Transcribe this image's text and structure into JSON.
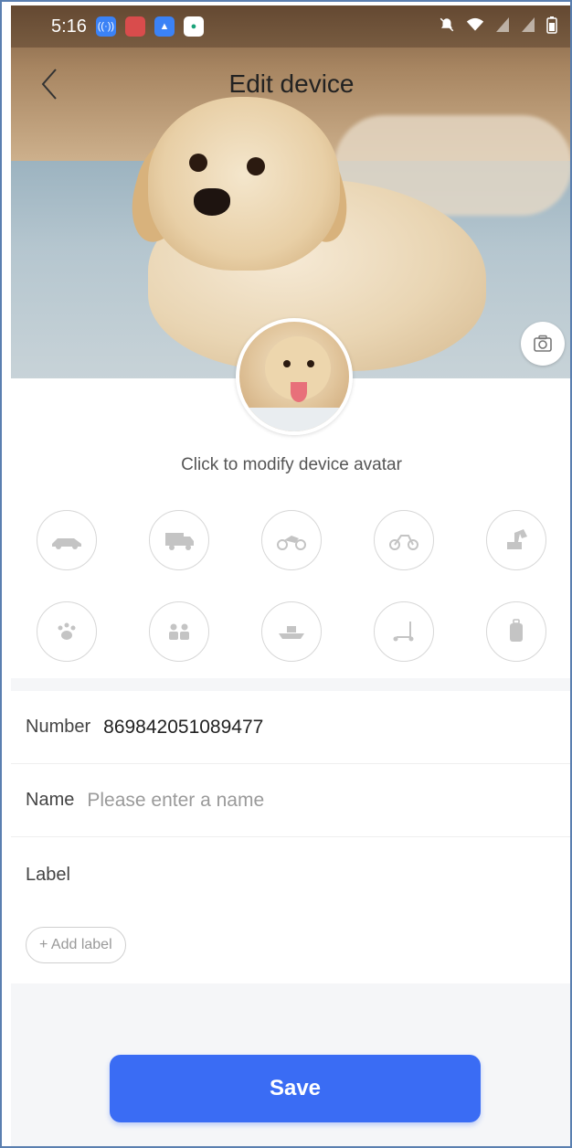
{
  "status_bar": {
    "time": "5:16",
    "app_icons": [
      "signal-app-icon",
      "red-app-icon",
      "mountain-app-icon",
      "location-app-icon"
    ],
    "right_icons": [
      "mute-icon",
      "wifi-icon",
      "signal-icon",
      "signal-icon",
      "battery-icon"
    ]
  },
  "header": {
    "title": "Edit device"
  },
  "avatar": {
    "hint": "Click to modify device avatar"
  },
  "device_types": {
    "row1": [
      "car-icon",
      "truck-icon",
      "motorcycle-icon",
      "bicycle-icon",
      "excavator-icon"
    ],
    "row2": [
      "paw-icon",
      "people-icon",
      "ship-icon",
      "scooter-icon",
      "suitcase-icon"
    ]
  },
  "form": {
    "number_label": "Number",
    "number_value": "869842051089477",
    "name_label": "Name",
    "name_placeholder": "Please enter a name",
    "name_value": "",
    "label_title": "Label",
    "add_label": "+ Add label"
  },
  "actions": {
    "save": "Save"
  },
  "colors": {
    "accent": "#3a6cf4",
    "band": "#f5f6f8"
  }
}
